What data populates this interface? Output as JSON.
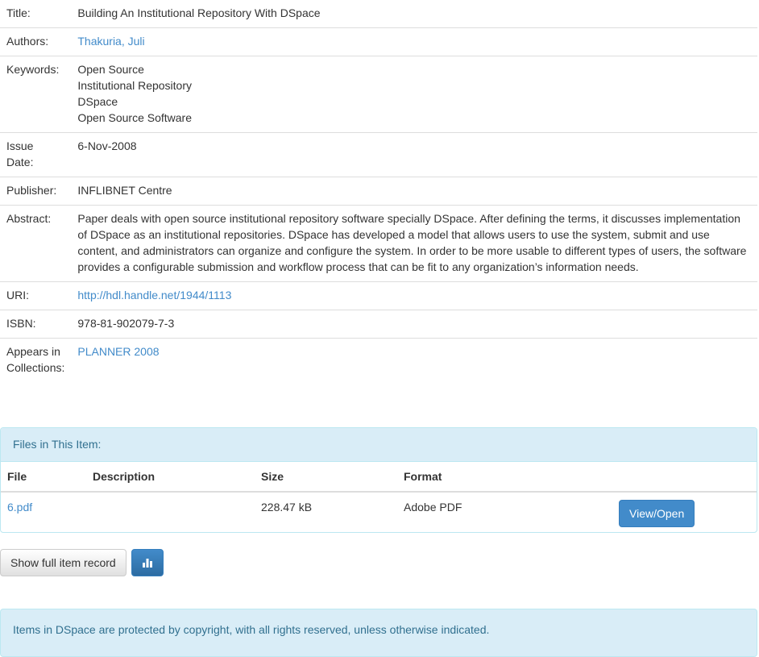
{
  "metadata": {
    "title_label": "Title:",
    "title_value": "Building An Institutional Repository With DSpace",
    "authors_label": "Authors:",
    "authors_value": "Thakuria, Juli",
    "keywords_label": "Keywords:",
    "keywords": [
      "Open Source",
      "Institutional Repository",
      "DSpace",
      "Open Source Software"
    ],
    "issue_date_label_1": "Issue",
    "issue_date_label_2": "Date:",
    "issue_date_value": "6-Nov-2008",
    "publisher_label": "Publisher:",
    "publisher_value": "INFLIBNET Centre",
    "abstract_label": "Abstract:",
    "abstract_value": "Paper deals with open source institutional repository software specially DSpace. After defining the terms, it discusses implementation of DSpace as an institutional repositories. DSpace has developed a model that allows users to use the system, submit and use content, and administrators can organize and configure the system. In order to be more usable to different types of users, the software provides a configurable submission and workflow process that can be fit to any organization’s information needs.",
    "uri_label": "URI:",
    "uri_value": "http://hdl.handle.net/1944/1113",
    "isbn_label": "ISBN:",
    "isbn_value": "978-81-902079-7-3",
    "collections_label_1": "Appears in",
    "collections_label_2": "Collections:",
    "collections_value": "PLANNER 2008"
  },
  "files_panel": {
    "heading": "Files in This Item:",
    "columns": [
      "File",
      "Description",
      "Size",
      "Format"
    ],
    "rows": [
      {
        "file": "6.pdf",
        "description": "",
        "size": "228.47 kB",
        "format": "Adobe PDF",
        "action": "View/Open"
      }
    ]
  },
  "actions": {
    "show_full_label": "Show full item record",
    "stats_icon": "bar-chart-icon"
  },
  "footer": {
    "notice": "Items in DSpace are protected by copyright, with all rights reserved, unless otherwise indicated."
  },
  "colors": {
    "link": "#428bca",
    "primary": "#428bca",
    "info_bg": "#d9edf7",
    "info_text": "#31708f"
  }
}
